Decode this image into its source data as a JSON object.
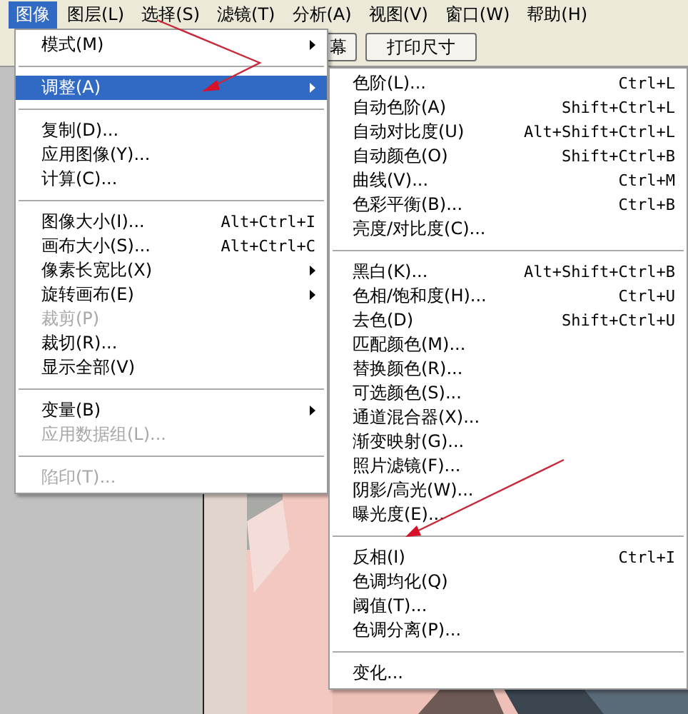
{
  "menubar": [
    {
      "label": "图像",
      "selected": true
    },
    {
      "label": "图层(L)",
      "selected": false
    },
    {
      "label": "选择(S)",
      "selected": false
    },
    {
      "label": "滤镜(T)",
      "selected": false
    },
    {
      "label": "分析(A)",
      "selected": false
    },
    {
      "label": "视图(V)",
      "selected": false
    },
    {
      "label": "窗口(W)",
      "selected": false
    },
    {
      "label": "帮助(H)",
      "selected": false
    }
  ],
  "toolbar_buttons": [
    "幕",
    "打印尺寸"
  ],
  "image_menu": [
    {
      "kind": "item",
      "label": "模式(M)",
      "submenu": true,
      "selected": false,
      "disabled": false
    },
    {
      "kind": "separator"
    },
    {
      "kind": "item",
      "label": "调整(A)",
      "submenu": true,
      "selected": true,
      "disabled": false
    },
    {
      "kind": "separator"
    },
    {
      "kind": "item",
      "label": "复制(D)...",
      "selected": false,
      "disabled": false
    },
    {
      "kind": "item",
      "label": "应用图像(Y)...",
      "selected": false,
      "disabled": false
    },
    {
      "kind": "item",
      "label": "计算(C)...",
      "selected": false,
      "disabled": false
    },
    {
      "kind": "separator"
    },
    {
      "kind": "item",
      "label": "图像大小(I)...",
      "shortcut": "Alt+Ctrl+I",
      "selected": false,
      "disabled": false
    },
    {
      "kind": "item",
      "label": "画布大小(S)...",
      "shortcut": "Alt+Ctrl+C",
      "selected": false,
      "disabled": false
    },
    {
      "kind": "item",
      "label": "像素长宽比(X)",
      "submenu": true,
      "selected": false,
      "disabled": false
    },
    {
      "kind": "item",
      "label": "旋转画布(E)",
      "submenu": true,
      "selected": false,
      "disabled": false
    },
    {
      "kind": "item",
      "label": "裁剪(P)",
      "selected": false,
      "disabled": true
    },
    {
      "kind": "item",
      "label": "裁切(R)...",
      "selected": false,
      "disabled": false
    },
    {
      "kind": "item",
      "label": "显示全部(V)",
      "selected": false,
      "disabled": false
    },
    {
      "kind": "separator"
    },
    {
      "kind": "item",
      "label": "变量(B)",
      "submenu": true,
      "selected": false,
      "disabled": false
    },
    {
      "kind": "item",
      "label": "应用数据组(L)...",
      "selected": false,
      "disabled": true
    },
    {
      "kind": "separator"
    },
    {
      "kind": "item",
      "label": "陷印(T)...",
      "selected": false,
      "disabled": true
    }
  ],
  "adjust_menu": [
    {
      "kind": "item",
      "label": "色阶(L)...",
      "shortcut": "Ctrl+L"
    },
    {
      "kind": "item",
      "label": "自动色阶(A)",
      "shortcut": "Shift+Ctrl+L"
    },
    {
      "kind": "item",
      "label": "自动对比度(U)",
      "shortcut": "Alt+Shift+Ctrl+L"
    },
    {
      "kind": "item",
      "label": "自动颜色(O)",
      "shortcut": "Shift+Ctrl+B"
    },
    {
      "kind": "item",
      "label": "曲线(V)...",
      "shortcut": "Ctrl+M"
    },
    {
      "kind": "item",
      "label": "色彩平衡(B)...",
      "shortcut": "Ctrl+B"
    },
    {
      "kind": "item",
      "label": "亮度/对比度(C)..."
    },
    {
      "kind": "separator"
    },
    {
      "kind": "item",
      "label": "黑白(K)...",
      "shortcut": "Alt+Shift+Ctrl+B"
    },
    {
      "kind": "item",
      "label": "色相/饱和度(H)...",
      "shortcut": "Ctrl+U"
    },
    {
      "kind": "item",
      "label": "去色(D)",
      "shortcut": "Shift+Ctrl+U"
    },
    {
      "kind": "item",
      "label": "匹配颜色(M)..."
    },
    {
      "kind": "item",
      "label": "替换颜色(R)..."
    },
    {
      "kind": "item",
      "label": "可选颜色(S)..."
    },
    {
      "kind": "item",
      "label": "通道混合器(X)..."
    },
    {
      "kind": "item",
      "label": "渐变映射(G)..."
    },
    {
      "kind": "item",
      "label": "照片滤镜(F)..."
    },
    {
      "kind": "item",
      "label": "阴影/高光(W)..."
    },
    {
      "kind": "item",
      "label": "曝光度(E)..."
    },
    {
      "kind": "separator"
    },
    {
      "kind": "item",
      "label": "反相(I)",
      "shortcut": "Ctrl+I"
    },
    {
      "kind": "item",
      "label": "色调均化(Q)"
    },
    {
      "kind": "item",
      "label": "阈值(T)..."
    },
    {
      "kind": "item",
      "label": "色调分离(P)..."
    },
    {
      "kind": "separator"
    },
    {
      "kind": "item",
      "label": "变化..."
    }
  ]
}
